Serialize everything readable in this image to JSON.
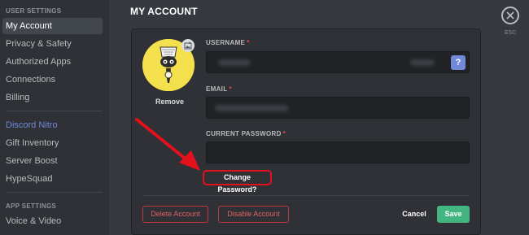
{
  "sidebar": {
    "user_settings_label": "USER SETTINGS",
    "items": [
      {
        "label": "My Account"
      },
      {
        "label": "Privacy & Safety"
      },
      {
        "label": "Authorized Apps"
      },
      {
        "label": "Connections"
      },
      {
        "label": "Billing"
      },
      {
        "label": "Discord Nitro"
      },
      {
        "label": "Gift Inventory"
      },
      {
        "label": "Server Boost"
      },
      {
        "label": "HypeSquad"
      },
      {
        "label": "Voice & Video"
      }
    ],
    "app_settings_label": "APP SETTINGS"
  },
  "main": {
    "title": "MY ACCOUNT",
    "avatar": {
      "remove_label": "Remove",
      "upload_icon": "image-upload-icon"
    },
    "fields": {
      "username_label": "USERNAME",
      "email_label": "EMAIL",
      "password_label": "CURRENT PASSWORD",
      "required_marker": "*",
      "help_symbol": "?"
    },
    "change_password_label": "Change Password?",
    "buttons": {
      "delete": "Delete Account",
      "disable": "Disable Account",
      "cancel": "Cancel",
      "save": "Save"
    }
  },
  "close": {
    "esc_label": "ESC",
    "icon": "close-icon"
  },
  "colors": {
    "accent": "#7289da",
    "save": "#43b581",
    "danger": "#f04747",
    "annotation": "#e2111b"
  }
}
